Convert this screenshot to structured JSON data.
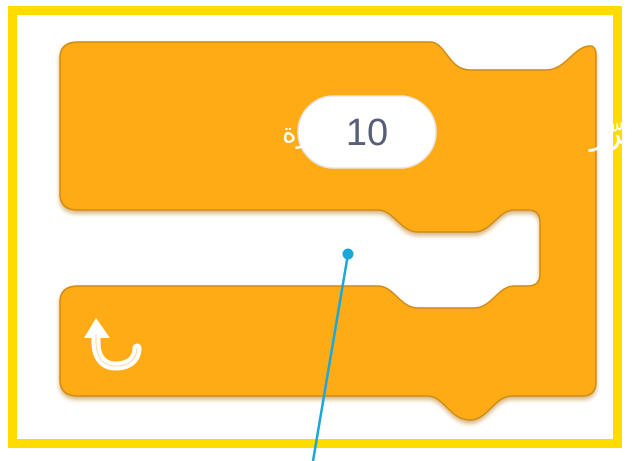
{
  "repeat_block": {
    "label": "كرّر",
    "count": "10",
    "unit": "مرة",
    "loop_arrow_icon": "loop-arrow-icon"
  },
  "colors": {
    "frame": "#FEDC00",
    "block_fill": "#FFAB19",
    "block_stroke": "#CF8B17",
    "input_fill": "#FFFFFF",
    "input_text": "#575E75",
    "connector": "#1BA7D8"
  }
}
